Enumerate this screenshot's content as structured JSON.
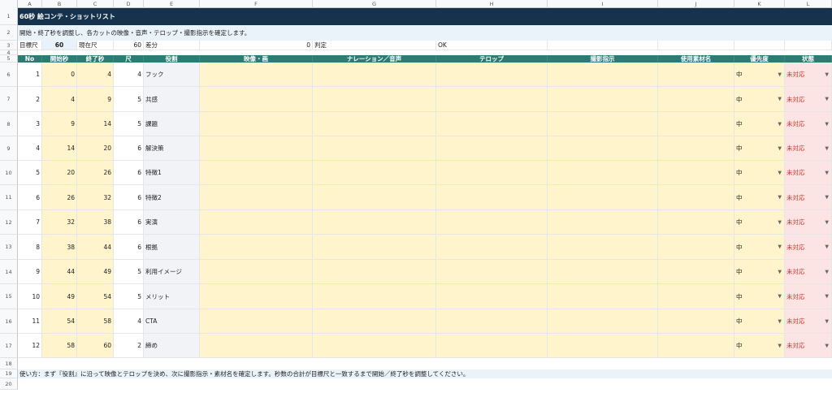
{
  "columns": [
    "A",
    "B",
    "C",
    "D",
    "E",
    "F",
    "G",
    "H",
    "I",
    "J",
    "K",
    "L"
  ],
  "title": "60秒 絵コンテ・ショットリスト",
  "description": "開始・終了秒を調整し、各カットの映像・音声・テロップ・撮影指示を確定します。",
  "summary": {
    "target_label": "目標尺",
    "target_value": "60",
    "current_label": "現在尺",
    "current_value": "60",
    "diff_label": "差分",
    "diff_value": "0",
    "judge_label": "判定",
    "judge_value": "OK"
  },
  "headers": [
    "No",
    "開始秒",
    "終了秒",
    "尺",
    "役割",
    "映像・画",
    "ナレーション／音声",
    "テロップ",
    "撮影指示",
    "使用素材名",
    "優先度",
    "状態"
  ],
  "rows": [
    {
      "no": "1",
      "start": "0",
      "end": "4",
      "dur": "4",
      "role": "フック",
      "priority": "中",
      "status": "未対応"
    },
    {
      "no": "2",
      "start": "4",
      "end": "9",
      "dur": "5",
      "role": "共感",
      "priority": "中",
      "status": "未対応"
    },
    {
      "no": "3",
      "start": "9",
      "end": "14",
      "dur": "5",
      "role": "課題",
      "priority": "中",
      "status": "未対応"
    },
    {
      "no": "4",
      "start": "14",
      "end": "20",
      "dur": "6",
      "role": "解決策",
      "priority": "中",
      "status": "未対応"
    },
    {
      "no": "5",
      "start": "20",
      "end": "26",
      "dur": "6",
      "role": "特徴1",
      "priority": "中",
      "status": "未対応"
    },
    {
      "no": "6",
      "start": "26",
      "end": "32",
      "dur": "6",
      "role": "特徴2",
      "priority": "中",
      "status": "未対応"
    },
    {
      "no": "7",
      "start": "32",
      "end": "38",
      "dur": "6",
      "role": "実演",
      "priority": "中",
      "status": "未対応"
    },
    {
      "no": "8",
      "start": "38",
      "end": "44",
      "dur": "6",
      "role": "根拠",
      "priority": "中",
      "status": "未対応"
    },
    {
      "no": "9",
      "start": "44",
      "end": "49",
      "dur": "5",
      "role": "利用イメージ",
      "priority": "中",
      "status": "未対応"
    },
    {
      "no": "10",
      "start": "49",
      "end": "54",
      "dur": "5",
      "role": "メリット",
      "priority": "中",
      "status": "未対応"
    },
    {
      "no": "11",
      "start": "54",
      "end": "58",
      "dur": "4",
      "role": "CTA",
      "priority": "中",
      "status": "未対応"
    },
    {
      "no": "12",
      "start": "58",
      "end": "60",
      "dur": "2",
      "role": "締め",
      "priority": "中",
      "status": "未対応"
    }
  ],
  "footer": "使い方：まず『役割』に沿って映像とテロップを決め、次に撮影指示・素材名を確定します。秒数の合計が目標尺と一致するまで開始／終了秒を調整してください。",
  "row_numbers": [
    "1",
    "2",
    "3",
    "4",
    "5",
    "6",
    "7",
    "8",
    "9",
    "10",
    "11",
    "12",
    "13",
    "14",
    "15",
    "16",
    "17",
    "18",
    "19",
    "20"
  ],
  "icons": {
    "dropdown": "dropdown-arrow-icon"
  },
  "colors": {
    "title_bg": "#17324d",
    "header_bg": "#2f7b73",
    "yellow": "#fff4cc",
    "pink": "#fde4e4",
    "status_text": "#c0392b"
  }
}
